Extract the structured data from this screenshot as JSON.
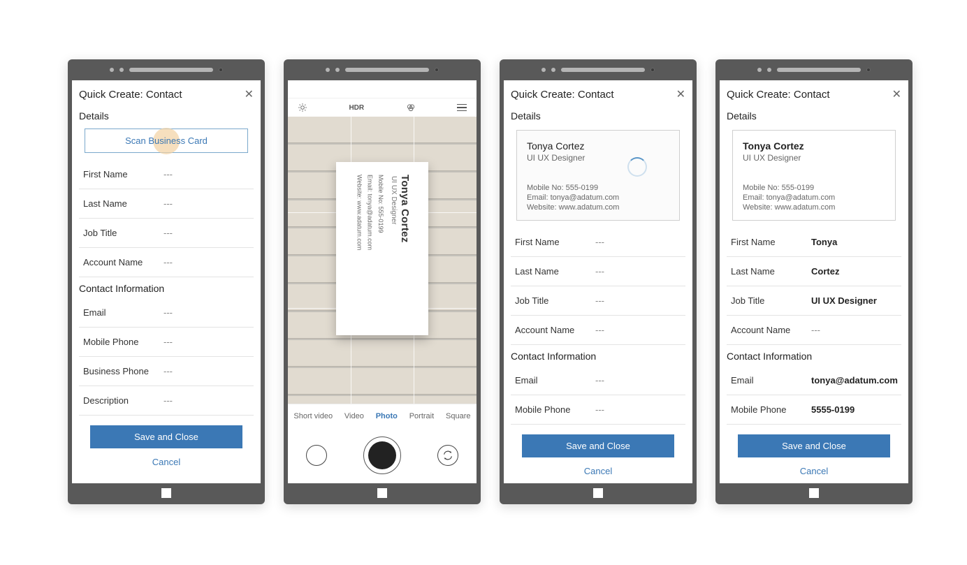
{
  "labels": {
    "header_title": "Quick Create: Contact",
    "section_details": "Details",
    "section_contact_info": "Contact Information",
    "scan_button": "Scan Business Card",
    "save": "Save and Close",
    "cancel": "Cancel",
    "empty": "---"
  },
  "fields": {
    "first_name": "First Name",
    "last_name": "Last Name",
    "job_title": "Job Title",
    "account_name": "Account Name",
    "email": "Email",
    "mobile_phone": "Mobile Phone",
    "business_phone": "Business Phone",
    "description": "Description"
  },
  "card": {
    "name": "Tonya Cortez",
    "title": "UI UX Designer",
    "mobile_line": "Mobile No: 555-0199",
    "email_line": "Email: tonya@adatum.com",
    "website_line": "Website: www.adatum.com"
  },
  "filled": {
    "first_name": "Tonya",
    "last_name": "Cortez",
    "job_title": "UI UX Designer",
    "email": "tonya@adatum.com",
    "mobile_phone": "5555-0199"
  },
  "camera": {
    "modes": {
      "short_video": "Short video",
      "video": "Video",
      "photo": "Photo",
      "portrait": "Portrait",
      "square": "Square"
    },
    "hdr_label": "HDR"
  }
}
